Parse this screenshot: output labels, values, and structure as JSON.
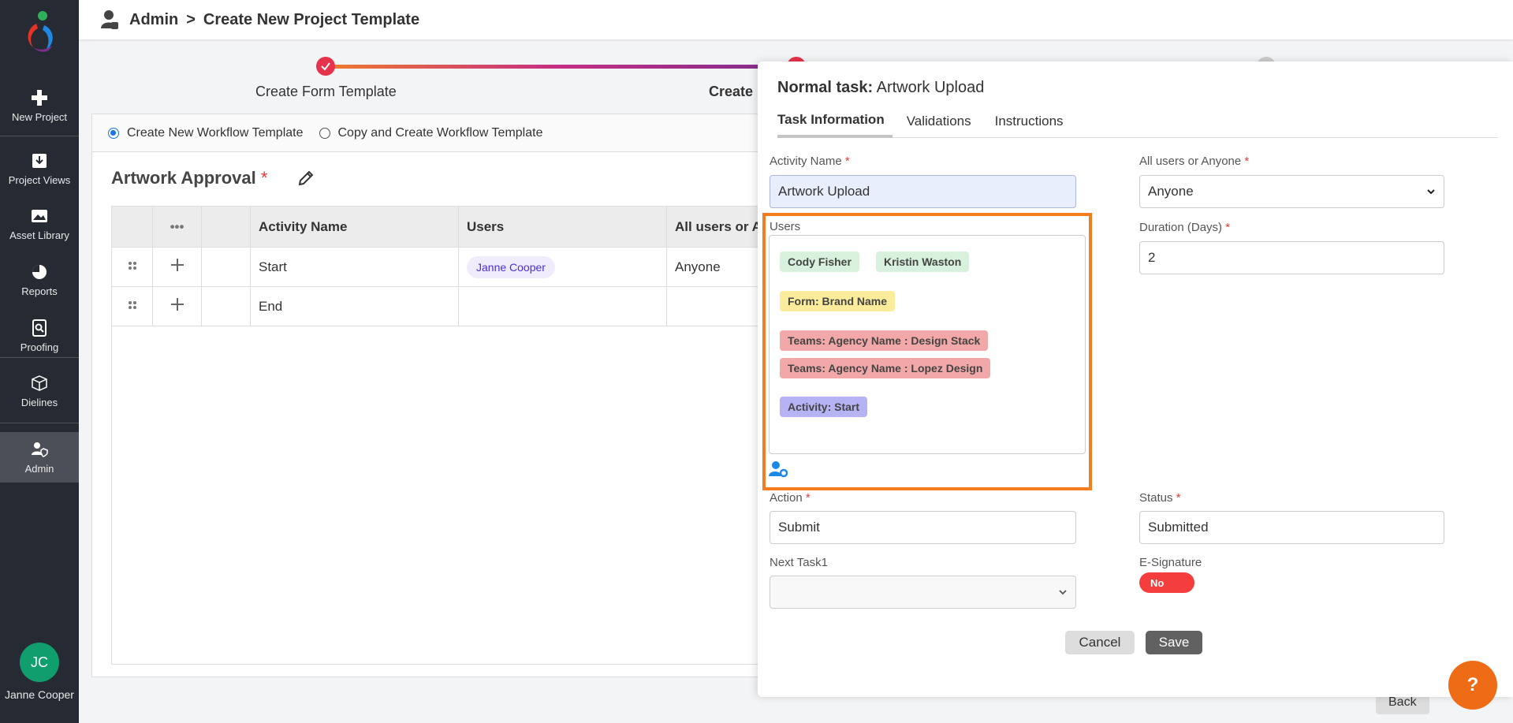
{
  "sidebar": {
    "items": [
      {
        "label": "New Project",
        "icon": "plus-icon"
      },
      {
        "label": "Project Views",
        "icon": "inbox-download-icon"
      },
      {
        "label": "Asset Library",
        "icon": "image-icon"
      },
      {
        "label": "Reports",
        "icon": "pie-chart-icon"
      },
      {
        "label": "Proofing",
        "icon": "document-search-icon"
      },
      {
        "label": "Dielines",
        "icon": "box-icon"
      },
      {
        "label": "Admin",
        "icon": "user-shield-icon"
      }
    ],
    "user": {
      "initials": "JC",
      "name": "Janne Cooper"
    }
  },
  "header": {
    "breadcrumb": [
      "Admin",
      "Create New Project Template"
    ],
    "separator": ">"
  },
  "stepper": {
    "steps": [
      {
        "label": "Create Form Template",
        "status": "complete"
      },
      {
        "label": "Create",
        "status": "active"
      }
    ]
  },
  "workflow": {
    "options": [
      "Create New Workflow Template",
      "Copy and Create Workflow Template"
    ],
    "selected": "Create New Workflow Template",
    "title": "Artwork Approval",
    "required_mark": "*",
    "columns": [
      "",
      "•••",
      "",
      "Activity Name",
      "Users",
      "All users or A"
    ],
    "rows": [
      {
        "activity": "Start",
        "user": "Janne Cooper",
        "mode": "Anyone"
      },
      {
        "activity": "End",
        "user": "",
        "mode": ""
      }
    ],
    "back_label": "Back"
  },
  "panel": {
    "title_prefix": "Normal task",
    "title_sep": ":",
    "title_name": "Artwork Upload",
    "tabs": [
      "Task Information",
      "Validations",
      "Instructions"
    ],
    "active_tab": "Task Information",
    "fields": {
      "activity_name": {
        "label": "Activity Name",
        "value": "Artwork Upload"
      },
      "all_users": {
        "label": "All users or Anyone",
        "value": "Anyone"
      },
      "users_label": "Users",
      "duration": {
        "label": "Duration (Days)",
        "value": "2"
      },
      "action": {
        "label": "Action",
        "value": "Submit"
      },
      "status": {
        "label": "Status",
        "value": "Submitted"
      },
      "next_task": {
        "label": "Next Task1",
        "value": ""
      },
      "esignature": {
        "label": "E-Signature",
        "value": "No"
      }
    },
    "user_tags": [
      {
        "text": "Cody Fisher",
        "kind": "user",
        "color": "#d7f1dc"
      },
      {
        "text": "Kristin Waston",
        "kind": "user",
        "color": "#d7f1dc"
      },
      {
        "text": "Form: Brand Name",
        "kind": "form",
        "color": "#fbec9b"
      },
      {
        "text": "Teams: Agency Name : Design Stack",
        "kind": "team",
        "color": "#f2a8a8"
      },
      {
        "text": "Teams: Agency Name : Lopez Design",
        "kind": "team",
        "color": "#f2a8a8"
      },
      {
        "text": "Activity: Start",
        "kind": "activity",
        "color": "#b5b3f4"
      }
    ],
    "cancel_label": "Cancel",
    "save_label": "Save",
    "highlight_color": "#f57c1f"
  },
  "help_label": "?"
}
